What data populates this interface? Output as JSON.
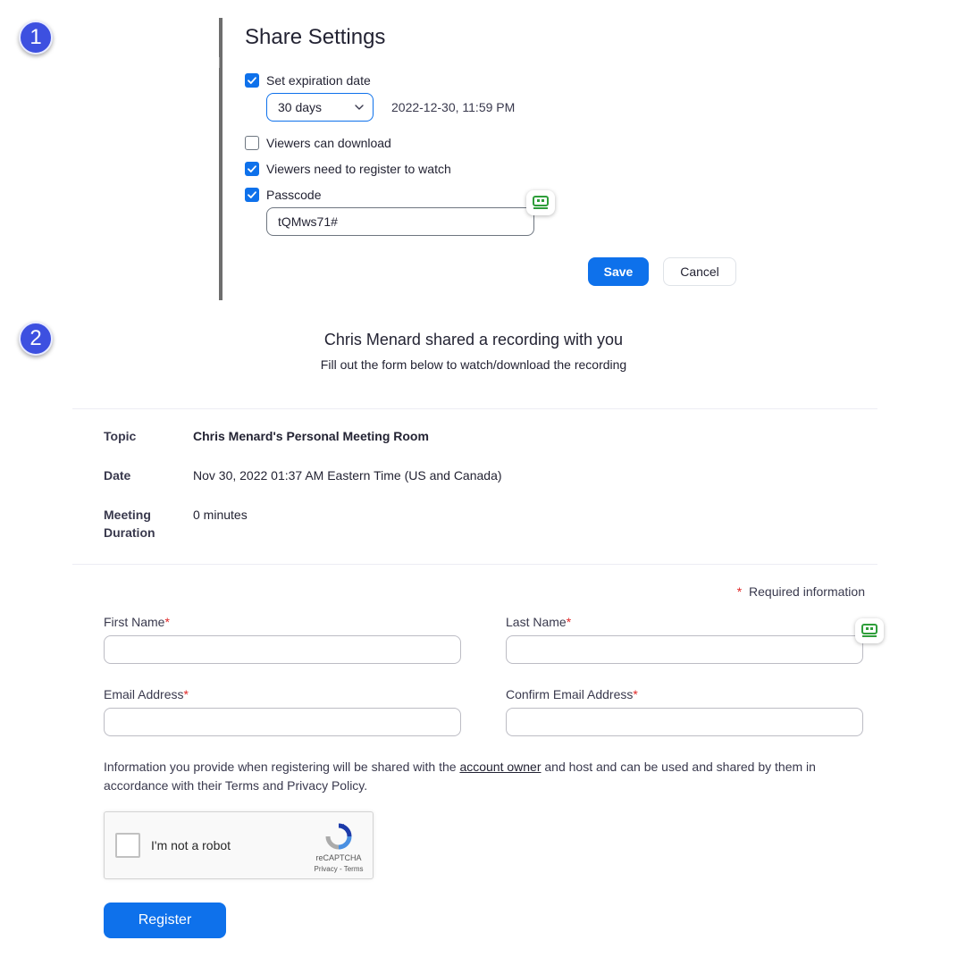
{
  "steps": {
    "step1": "1",
    "step2": "2"
  },
  "share_settings": {
    "title": "Share Settings",
    "expiration": {
      "label": "Set expiration date",
      "checked": true,
      "selected_option": "30 days",
      "expiration_text": "2022-12-30, 11:59 PM"
    },
    "viewers_download": {
      "label": "Viewers can download",
      "checked": false
    },
    "viewers_register": {
      "label": "Viewers need to register to watch",
      "checked": true
    },
    "passcode": {
      "label": "Passcode",
      "checked": true,
      "value": "tQMws71#"
    },
    "save_label": "Save",
    "cancel_label": "Cancel"
  },
  "recording": {
    "title": "Chris Menard shared a recording with you",
    "subtitle": "Fill out the form below to watch/download the recording",
    "details": {
      "topic_label": "Topic",
      "topic_value": "Chris Menard's Personal Meeting Room",
      "date_label": "Date",
      "date_value": "Nov 30, 2022 01:37 AM Eastern Time (US and Canada)",
      "duration_label_line1": "Meeting",
      "duration_label_line2": "Duration",
      "duration_value": "0 minutes"
    },
    "form": {
      "required_star": "*",
      "required_note": "Required information",
      "first_name_label": "First Name",
      "last_name_label": "Last Name",
      "email_label": "Email Address",
      "confirm_email_label": "Confirm Email Address",
      "disclaimer_before": "Information you provide when registering will be shared with the ",
      "disclaimer_link": "account owner",
      "disclaimer_after": " and host and can be used and shared by them in accordance with their Terms and Privacy Policy.",
      "captcha_label": "I'm not a robot",
      "captcha_brand": "reCAPTCHA",
      "captcha_links": "Privacy - Terms",
      "register_label": "Register"
    }
  },
  "colors": {
    "primary": "#0e71eb",
    "step_badge": "#3d50e0",
    "required": "#e02828",
    "extension_green": "#2e9e3a"
  }
}
